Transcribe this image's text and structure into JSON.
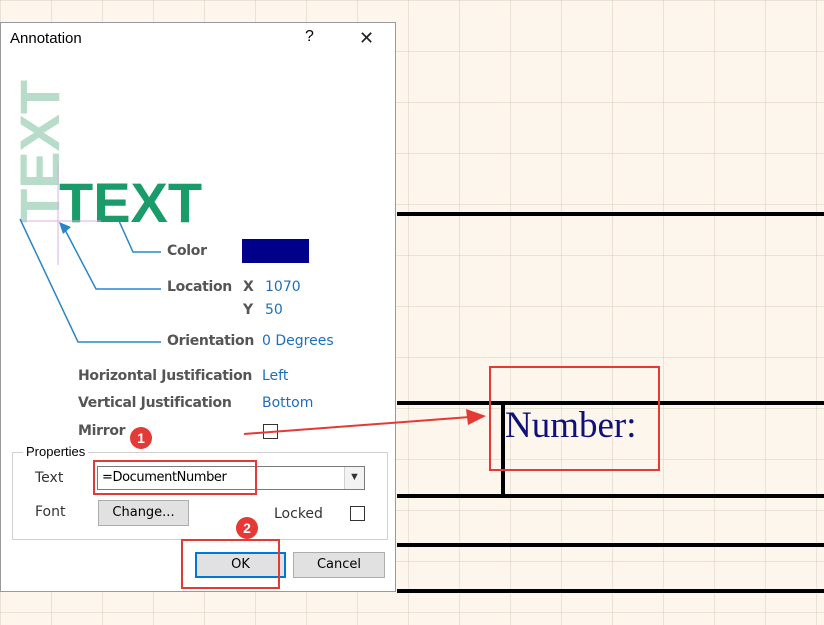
{
  "dialog": {
    "title": "Annotation",
    "help": "?",
    "close": "✕",
    "preview_text_vertical": "TEXT",
    "preview_text": "TEXT",
    "color_label": "Color",
    "color_value": "#00008b",
    "location_label": "Location",
    "x_label": "X",
    "x_value": "1070",
    "y_label": "Y",
    "y_value": "50",
    "orientation_label": "Orientation",
    "orientation_value": "0 Degrees",
    "hjust_label": "Horizontal Justification",
    "hjust_value": "Left",
    "vjust_label": "Vertical Justification",
    "vjust_value": "Bottom",
    "mirror_label": "Mirror",
    "properties": {
      "title": "Properties",
      "text_label": "Text",
      "text_value": "=DocumentNumber",
      "font_label": "Font",
      "change_button": "Change...",
      "locked_label": "Locked"
    },
    "ok_button": "OK",
    "cancel_button": "Cancel"
  },
  "sheet": {
    "field_text": "Number:"
  },
  "badges": [
    "1",
    "2"
  ],
  "colors": {
    "accent_green": "#1a9c6a",
    "annotation_red": "#e53935",
    "link_blue": "#1e6fb8"
  }
}
